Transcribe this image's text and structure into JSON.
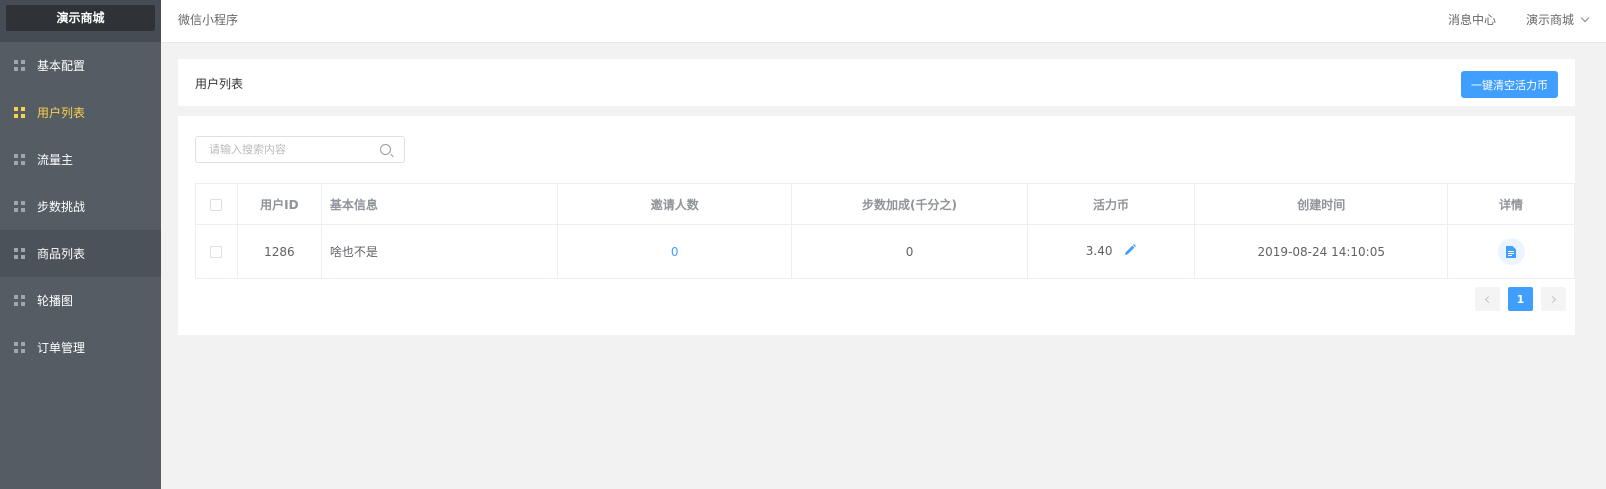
{
  "brand": "演示商城",
  "menu": [
    {
      "label": "基本配置"
    },
    {
      "label": "用户列表"
    },
    {
      "label": "流量主"
    },
    {
      "label": "步数挑战"
    },
    {
      "label": "商品列表"
    },
    {
      "label": "轮播图"
    },
    {
      "label": "订单管理"
    }
  ],
  "topbar": {
    "breadcrumb": "微信小程序",
    "messages": "消息中心",
    "user": "演示商城"
  },
  "header": {
    "title": "用户列表",
    "clear_button": "一键清空活力币"
  },
  "search": {
    "placeholder": "请输入搜索内容"
  },
  "table": {
    "columns": [
      "用户ID",
      "基本信息",
      "邀请人数",
      "步数加成(千分之)",
      "活力币",
      "创建时间",
      "详情"
    ],
    "rows": [
      {
        "id": "1286",
        "info": "啥也不是",
        "invites": "0",
        "step_bonus": "0",
        "coins": "3.40",
        "created": "2019-08-24 14:10:05"
      }
    ]
  },
  "pagination": {
    "current": "1"
  },
  "colors": {
    "sidebar": "#545c64",
    "active_menu": "#ffd04b",
    "primary": "#409eff"
  }
}
